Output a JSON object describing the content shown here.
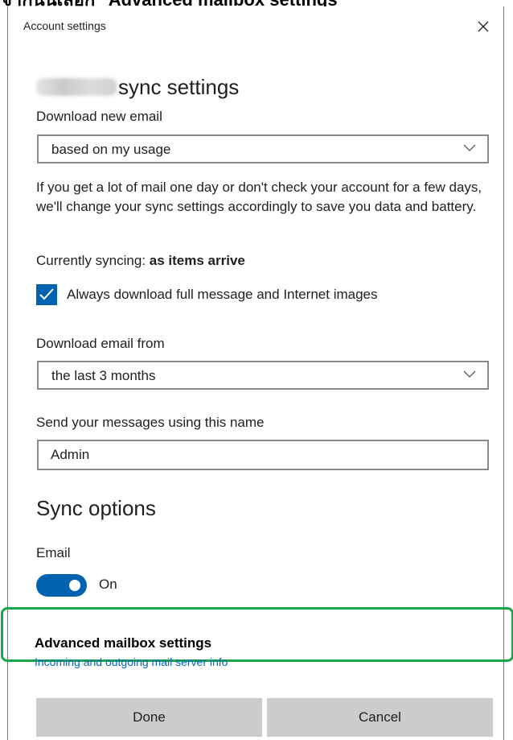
{
  "caption": "จากนั้นเลือก \"Advanced mailbox settings\"",
  "window": {
    "title": "Account settings"
  },
  "account": {
    "sync_heading": "sync settings"
  },
  "download_new_email": {
    "label": "Download new email",
    "selected": "based on my usage",
    "help": "If you get a lot of mail one day or don't check your account for a few days, we'll change your sync settings accordingly to save you data and battery."
  },
  "currently_syncing": {
    "label": "Currently syncing: ",
    "value": "as items arrive"
  },
  "full_message_checkbox": {
    "label": "Always download full message and Internet images",
    "checked": true
  },
  "download_email_from": {
    "label": "Download email from",
    "selected": "the last 3 months"
  },
  "send_name": {
    "label": "Send your messages using this name",
    "value": "Admin"
  },
  "sync_options": {
    "title": "Sync options",
    "email_label": "Email",
    "toggle_state": "On",
    "toggle_on": true
  },
  "advanced": {
    "title": "Advanced mailbox settings",
    "link": "Incoming and outgoing mail server info"
  },
  "buttons": {
    "done": "Done",
    "cancel": "Cancel"
  },
  "colors": {
    "accent": "#0063b1",
    "highlight": "#1aa64a",
    "link": "#0067c0",
    "button_bg": "#cccccc"
  },
  "icons": {
    "close": "close-icon",
    "chevron": "chevron-down-icon",
    "check": "checkmark-icon"
  }
}
